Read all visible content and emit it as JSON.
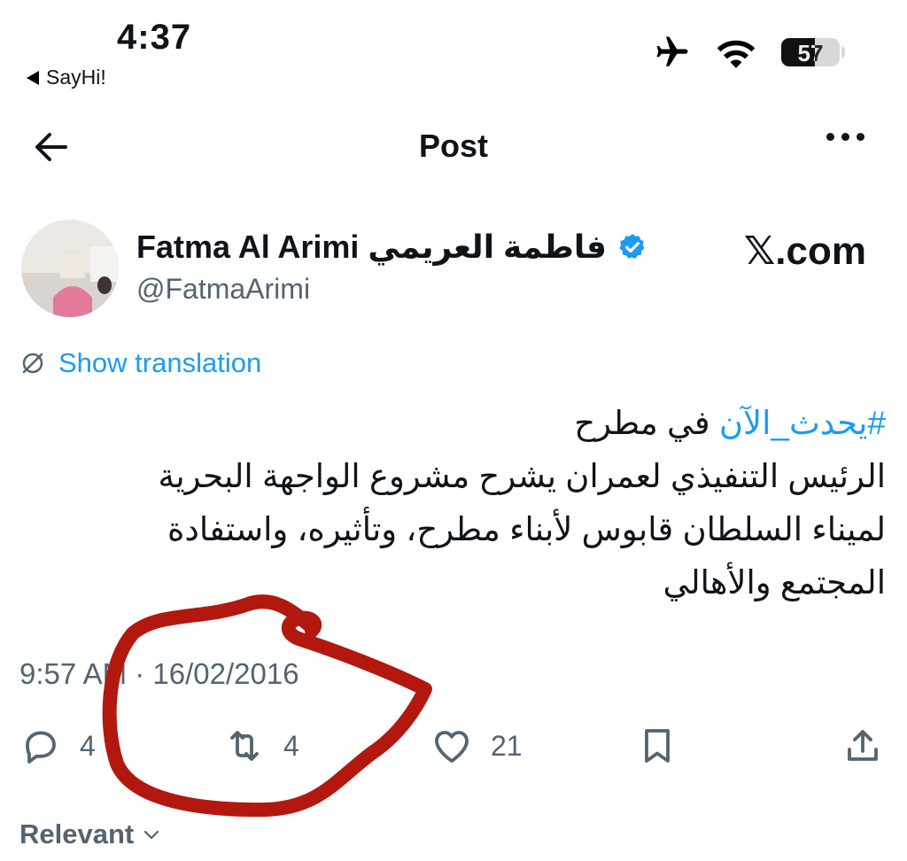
{
  "status_bar": {
    "time": "4:37",
    "back_app": "SayHi!",
    "battery": "57",
    "icons": [
      "airplane-icon",
      "wifi-icon",
      "battery-icon"
    ]
  },
  "nav": {
    "title": "Post",
    "back_icon": "arrow-left-icon",
    "more_icon": "more-horizontal-icon"
  },
  "author": {
    "name": "Fatma Al Arimi فاطمة العريمي",
    "handle": "@FatmaArimi",
    "verified_icon": "verified-badge-icon"
  },
  "watermark": "𝕏.com",
  "translation_label": "Show translation",
  "tweet": {
    "hashtag": "#يحدث_الآن",
    "first_line_rest": " في مطرح",
    "body": "الرئيس التنفيذي لعمران يشرح مشروع الواجهة البحرية لميناء السلطان قابوس لأبناء مطرح، وتأثيره، واستفادة المجتمع والأهالي"
  },
  "timestamp": "9:57 AM · 16/02/2016",
  "actions": {
    "replies": "4",
    "reposts": "4",
    "likes": "21"
  },
  "replies_sort": "Relevant",
  "colors": {
    "link": "#1d9bf0",
    "secondary_text": "#536471",
    "primary_text": "#0f1419",
    "annotation_red": "#b3180f"
  }
}
